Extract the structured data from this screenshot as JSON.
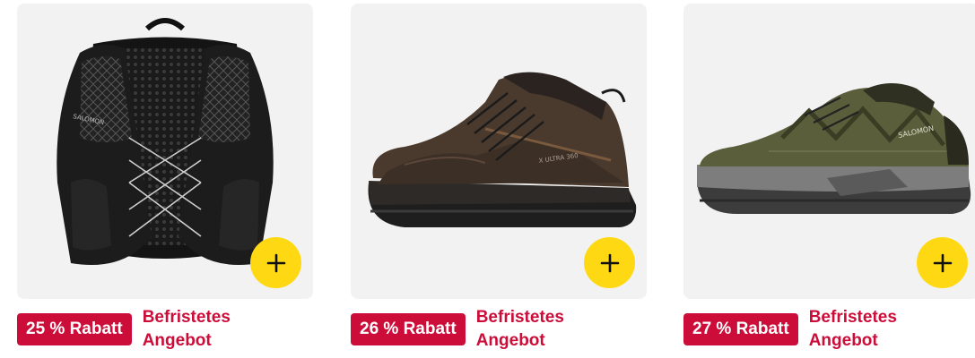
{
  "products": [
    {
      "image_icon": "running-vest-image",
      "discount": "25 % Rabatt",
      "deal": "Befristetes Angebot",
      "brand_print": "SALOMON",
      "add_icon": "plus-icon"
    },
    {
      "image_icon": "hiking-boot-image",
      "discount": "26 % Rabatt",
      "deal": "Befristetes Angebot",
      "brand_print": "X ULTRA 360",
      "add_icon": "plus-icon"
    },
    {
      "image_icon": "trail-shoe-image",
      "discount": "27 % Rabatt",
      "deal": "Befristetes Angebot",
      "brand_print": "SALOMON",
      "add_icon": "plus-icon"
    }
  ],
  "colors": {
    "badge": "#cc0c39",
    "add_button": "#ffd814",
    "image_bg": "#f2f2f2"
  }
}
